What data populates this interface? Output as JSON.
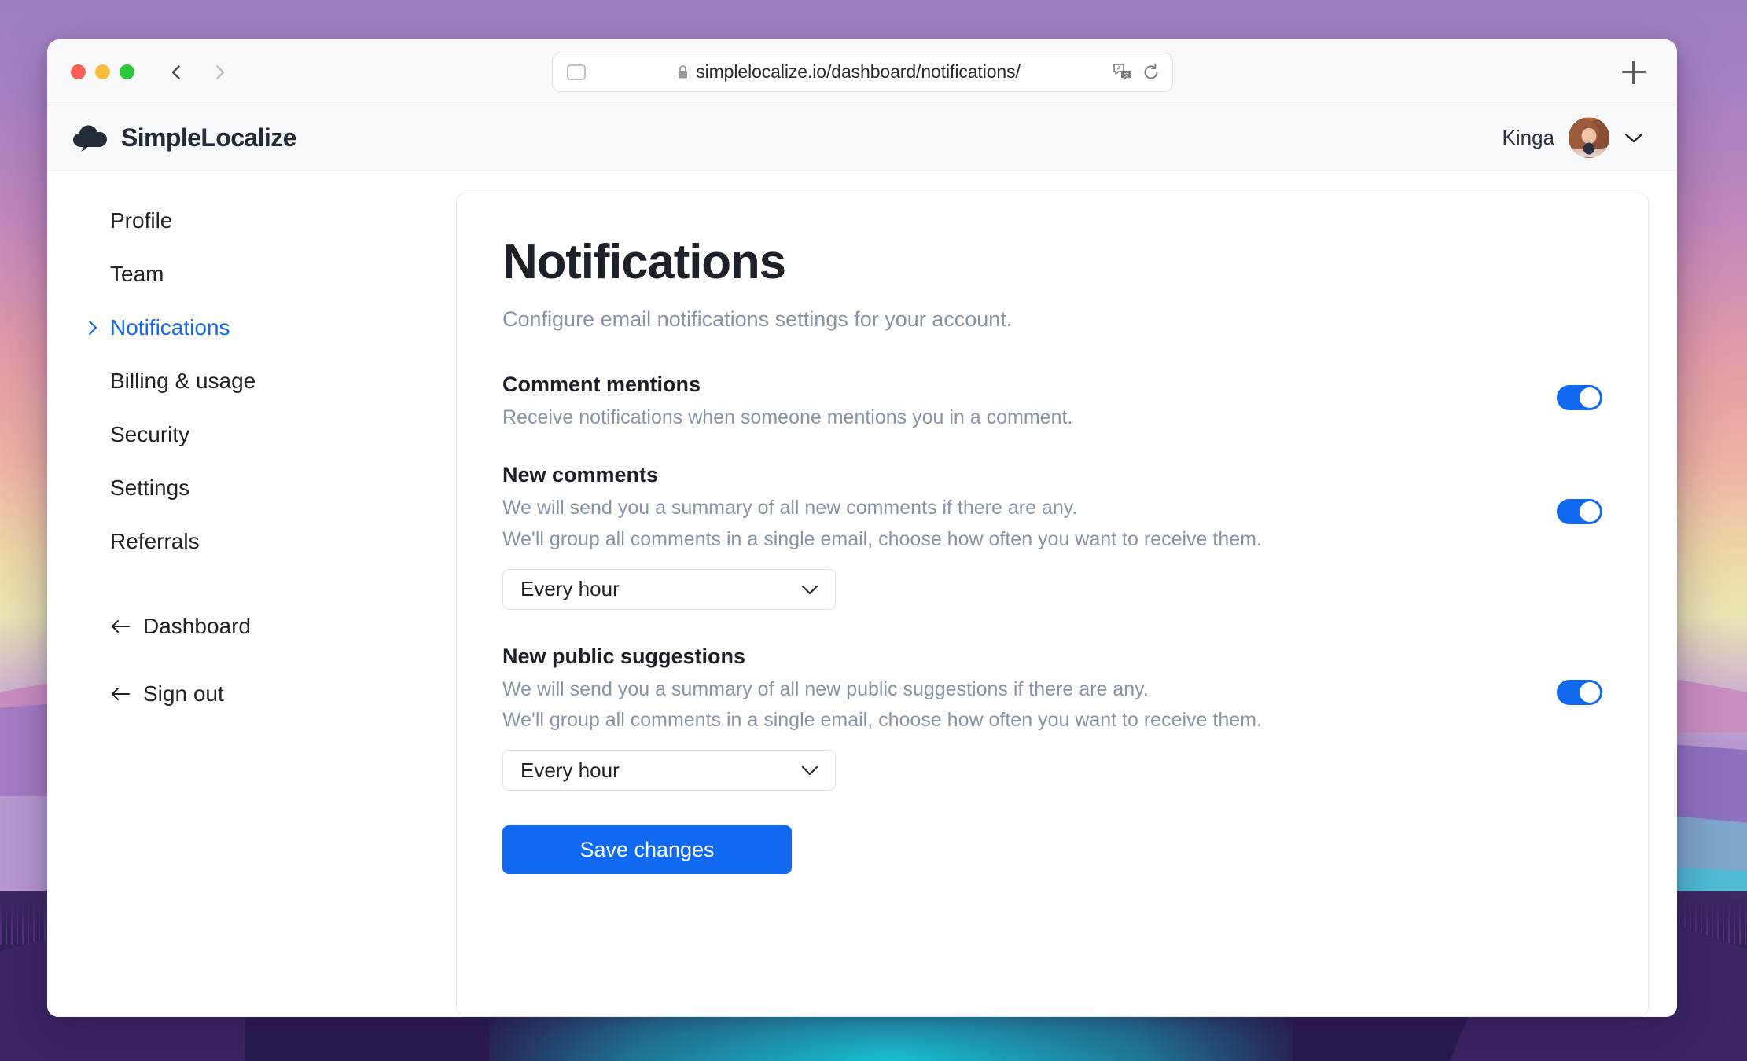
{
  "browser": {
    "url": "simplelocalize.io/dashboard/notifications/",
    "icons": {
      "sidebar": "sidebar-toggle-icon",
      "lock": "lock-icon",
      "translate": "translate-icon",
      "reload": "reload-icon",
      "back": "back-chevron-icon",
      "forward": "forward-chevron-icon",
      "new_tab": "plus-icon"
    },
    "window_controls": [
      "close",
      "minimize",
      "maximize"
    ]
  },
  "app_header": {
    "brand": "SimpleLocalize",
    "logo_icon": "cloud-logo-icon",
    "user_name": "Kinga",
    "avatar_icon": "user-avatar",
    "caret_icon": "chevron-down-icon"
  },
  "sidebar": {
    "items": [
      {
        "label": "Profile",
        "active": false
      },
      {
        "label": "Team",
        "active": false
      },
      {
        "label": "Notifications",
        "active": true
      },
      {
        "label": "Billing & usage",
        "active": false
      },
      {
        "label": "Security",
        "active": false
      },
      {
        "label": "Settings",
        "active": false
      },
      {
        "label": "Referrals",
        "active": false
      }
    ],
    "links": [
      {
        "label": "Dashboard",
        "icon": "arrow-left-icon"
      },
      {
        "label": "Sign out",
        "icon": "arrow-left-icon"
      }
    ]
  },
  "main": {
    "title": "Notifications",
    "subtitle": "Configure email notifications settings for your account.",
    "settings": [
      {
        "title": "Comment mentions",
        "lines": [
          "Receive notifications when someone mentions you in a comment."
        ],
        "toggle_on": true,
        "select": null
      },
      {
        "title": "New comments",
        "lines": [
          "We will send you a summary of all new comments if there are any.",
          "We'll group all comments in a single email, choose how often you want to receive them."
        ],
        "toggle_on": true,
        "select": {
          "value": "Every hour",
          "chevron_icon": "chevron-down-icon"
        }
      },
      {
        "title": "New public suggestions",
        "lines": [
          "We will send you a summary of all new public suggestions if there are any.",
          "We'll group all comments in a single email, choose how often you want to receive them."
        ],
        "toggle_on": true,
        "select": {
          "value": "Every hour",
          "chevron_icon": "chevron-down-icon"
        }
      }
    ],
    "save_label": "Save changes"
  },
  "colors": {
    "accent": "#1169f0",
    "active_link": "#1669e3",
    "muted_text": "#8794a6",
    "heading": "#1d2229"
  }
}
